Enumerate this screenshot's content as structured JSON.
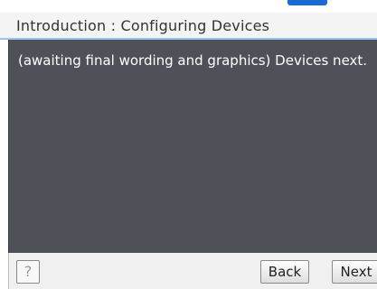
{
  "header": {
    "title": "Introduction : Configuring Devices"
  },
  "content": {
    "message": "(awaiting final wording and graphics) Devices next."
  },
  "footer": {
    "help_label": "?",
    "back_label": "Back",
    "next_label": "Next"
  },
  "colors": {
    "content_background": "#4e5258",
    "title_underline": "#9ec2ea",
    "accent": "#1a6ad6"
  }
}
